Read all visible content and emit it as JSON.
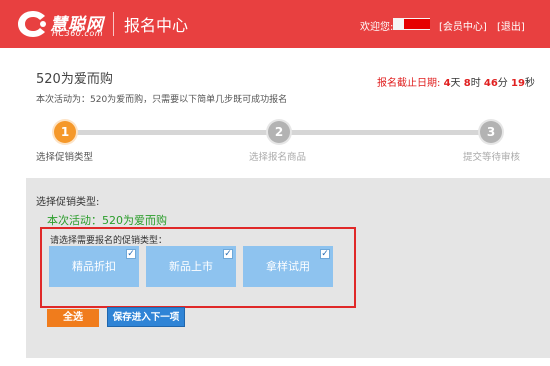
{
  "header": {
    "brand": "慧聪网",
    "domain": "HC360.com",
    "title": "报名中心",
    "welcome": "欢迎您:",
    "member_link": "[会员中心]",
    "logout_link": "[退出]",
    "color": "#e84040"
  },
  "activity": {
    "title": "520为爱而购",
    "description": "本次活动为：520为爱而购，只需要以下简单几步既可成功报名"
  },
  "deadline": {
    "label": "报名截止日期:",
    "days": "4",
    "days_unit": "天",
    "hours": "8",
    "hours_unit": "时",
    "minutes": "46",
    "minutes_unit": "分",
    "seconds": "19",
    "seconds_unit": "秒"
  },
  "steps": [
    {
      "number": "1",
      "label": "选择促销类型",
      "active": true
    },
    {
      "number": "2",
      "label": "选择报名商品",
      "active": false
    },
    {
      "number": "3",
      "label": "提交等待审核",
      "active": false
    }
  ],
  "selection": {
    "label": "选择促销类型:",
    "activity_line": "本次活动：520为爱而购",
    "prompt": "请选择需要报名的促销类型：",
    "types": [
      {
        "label": "精品折扣",
        "checked": true
      },
      {
        "label": "新品上市",
        "checked": true
      },
      {
        "label": "拿样试用",
        "checked": true
      }
    ]
  },
  "buttons": {
    "select_all": "全选",
    "save_next": "保存进入下一项"
  },
  "colors": {
    "accent": "#e84040",
    "step_active": "#f5982a",
    "card": "#8ec3ef",
    "select_all": "#f07c1c",
    "save_next": "#2f84d6",
    "activity_green": "#2a9d2a"
  }
}
